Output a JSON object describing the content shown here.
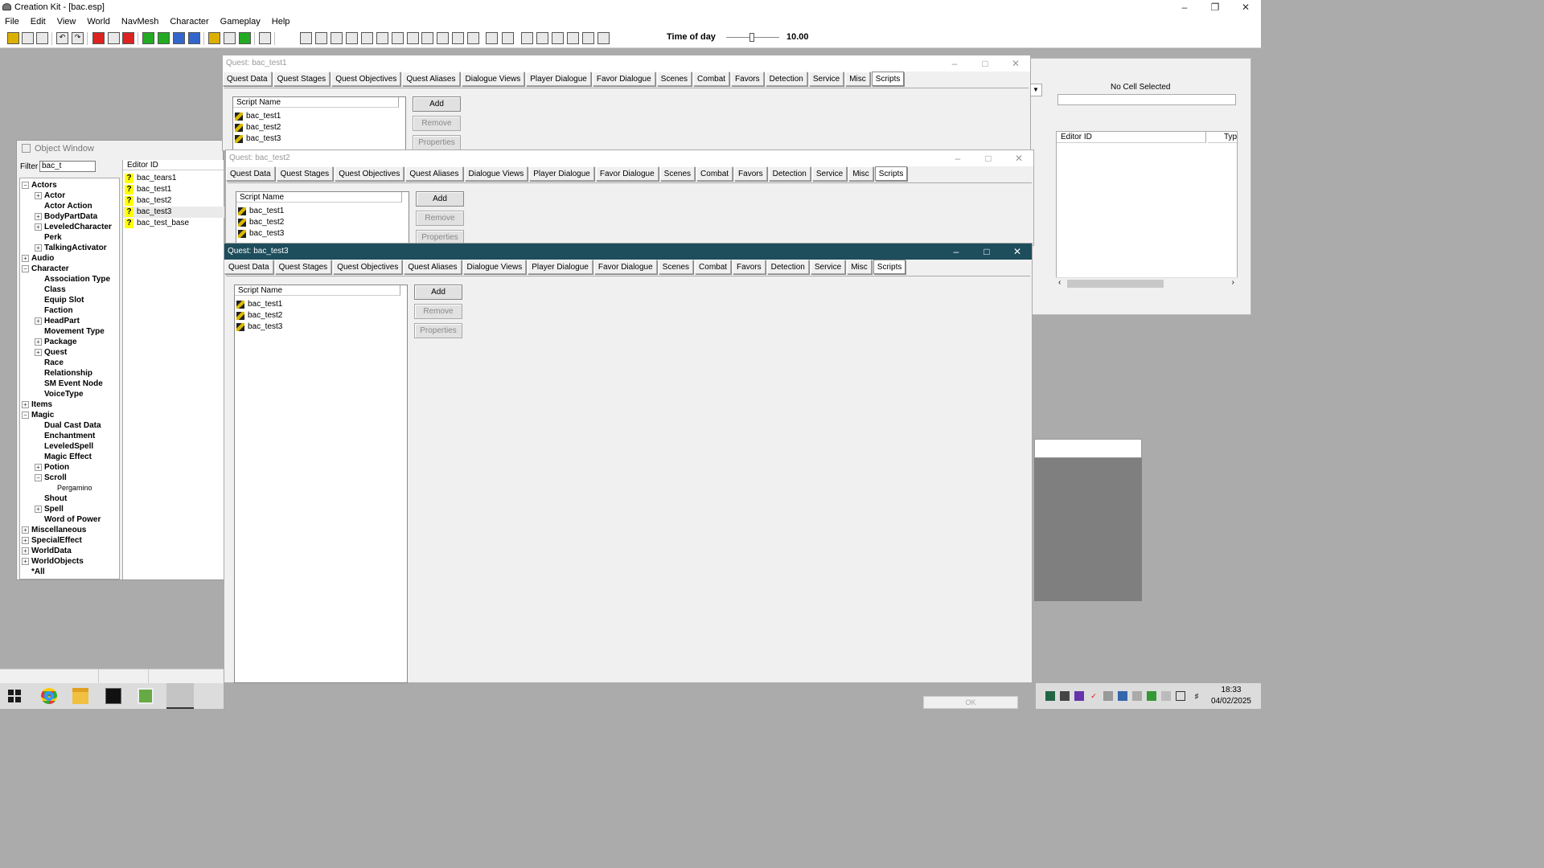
{
  "app": {
    "title": "Creation Kit - [bac.esp]"
  },
  "menu": [
    "File",
    "Edit",
    "View",
    "World",
    "NavMesh",
    "Character",
    "Gameplay",
    "Help"
  ],
  "time_of_day": {
    "label": "Time of day",
    "value": "10.00"
  },
  "object_window": {
    "title": "Object Window",
    "filter_label": "Filter",
    "filter_value": "bac_t",
    "editor_id_header": "Editor ID",
    "tree": [
      {
        "label": "Actors",
        "level": 0,
        "exp": "-"
      },
      {
        "label": "Actor",
        "level": 1,
        "exp": "+"
      },
      {
        "label": "Actor Action",
        "level": 1,
        "exp": ""
      },
      {
        "label": "BodyPartData",
        "level": 1,
        "exp": "+"
      },
      {
        "label": "LeveledCharacter",
        "level": 1,
        "exp": "+"
      },
      {
        "label": "Perk",
        "level": 1,
        "exp": ""
      },
      {
        "label": "TalkingActivator",
        "level": 1,
        "exp": "+"
      },
      {
        "label": "Audio",
        "level": 0,
        "exp": "+"
      },
      {
        "label": "Character",
        "level": 0,
        "exp": "-"
      },
      {
        "label": "Association Type",
        "level": 1,
        "exp": ""
      },
      {
        "label": "Class",
        "level": 1,
        "exp": ""
      },
      {
        "label": "Equip Slot",
        "level": 1,
        "exp": ""
      },
      {
        "label": "Faction",
        "level": 1,
        "exp": ""
      },
      {
        "label": "HeadPart",
        "level": 1,
        "exp": "+"
      },
      {
        "label": "Movement Type",
        "level": 1,
        "exp": ""
      },
      {
        "label": "Package",
        "level": 1,
        "exp": "+"
      },
      {
        "label": "Quest",
        "level": 1,
        "exp": "+"
      },
      {
        "label": "Race",
        "level": 1,
        "exp": ""
      },
      {
        "label": "Relationship",
        "level": 1,
        "exp": ""
      },
      {
        "label": "SM Event Node",
        "level": 1,
        "exp": ""
      },
      {
        "label": "VoiceType",
        "level": 1,
        "exp": ""
      },
      {
        "label": "Items",
        "level": 0,
        "exp": "+"
      },
      {
        "label": "Magic",
        "level": 0,
        "exp": "-"
      },
      {
        "label": "Dual Cast Data",
        "level": 1,
        "exp": ""
      },
      {
        "label": "Enchantment",
        "level": 1,
        "exp": ""
      },
      {
        "label": "LeveledSpell",
        "level": 1,
        "exp": ""
      },
      {
        "label": "Magic Effect",
        "level": 1,
        "exp": ""
      },
      {
        "label": "Potion",
        "level": 1,
        "exp": "+"
      },
      {
        "label": "Scroll",
        "level": 1,
        "exp": "-"
      },
      {
        "label": "Pergamino",
        "level": 2,
        "exp": ""
      },
      {
        "label": "Shout",
        "level": 1,
        "exp": ""
      },
      {
        "label": "Spell",
        "level": 1,
        "exp": "+"
      },
      {
        "label": "Word of Power",
        "level": 1,
        "exp": ""
      },
      {
        "label": "Miscellaneous",
        "level": 0,
        "exp": "+"
      },
      {
        "label": "SpecialEffect",
        "level": 0,
        "exp": "+"
      },
      {
        "label": "WorldData",
        "level": 0,
        "exp": "+"
      },
      {
        "label": "WorldObjects",
        "level": 0,
        "exp": "+"
      },
      {
        "label": "*All",
        "level": 0,
        "exp": ""
      }
    ],
    "items": [
      "bac_tears1",
      "bac_test1",
      "bac_test2",
      "bac_test3",
      "bac_test_base"
    ]
  },
  "cell_view": {
    "no_cell": "No Cell Selected",
    "editor_id_header": "Editor ID",
    "type_header": "Typ"
  },
  "quest_tabs": [
    "Quest Data",
    "Quest Stages",
    "Quest Objectives",
    "Quest Aliases",
    "Dialogue Views",
    "Player Dialogue",
    "Favor Dialogue",
    "Scenes",
    "Combat",
    "Favors",
    "Detection",
    "Service",
    "Misc",
    "Scripts"
  ],
  "quests": [
    {
      "title": "Quest: bac_test1",
      "script_header": "Script Name",
      "scripts": [
        "bac_test1",
        "bac_test2",
        "bac_test3"
      ],
      "add": "Add",
      "remove": "Remove",
      "properties": "Properties"
    },
    {
      "title": "Quest: bac_test2",
      "script_header": "Script Name",
      "scripts": [
        "bac_test1",
        "bac_test2",
        "bac_test3"
      ],
      "add": "Add",
      "remove": "Remove",
      "properties": "Properties"
    },
    {
      "title": "Quest: bac_test3",
      "script_header": "Script Name",
      "scripts": [
        "bac_test1",
        "bac_test2",
        "bac_test3"
      ],
      "add": "Add",
      "remove": "Remove",
      "properties": "Properties"
    }
  ],
  "ok_button": "OK",
  "clock": {
    "time": "18:33",
    "date": "04/02/2025"
  }
}
